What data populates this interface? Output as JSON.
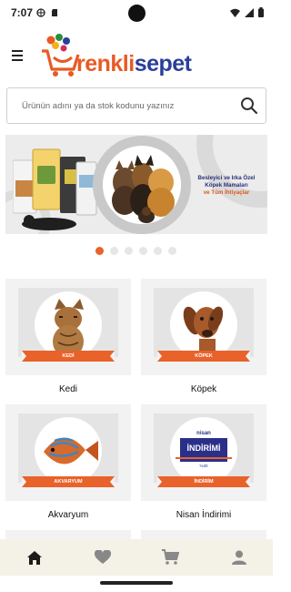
{
  "status_bar": {
    "time": "7:07"
  },
  "header": {
    "logo_text_part1": "renkli",
    "logo_text_part2": "sepet",
    "brand_colors": {
      "orange": "#e85a24",
      "blue": "#2a3f9a"
    }
  },
  "search": {
    "placeholder": "Ürünün adını ya da stok kodunu yazınız",
    "icon": "search-icon"
  },
  "banner": {
    "line1": "Besleyici ve Irka Özel",
    "line2": "Köpek Mamaları",
    "line3": "ve Tüm İhtiyaçlar",
    "slide_count": 6,
    "active_slide": 1
  },
  "categories": [
    {
      "label": "Kedi",
      "ribbon": "KEDİ"
    },
    {
      "label": "Köpek",
      "ribbon": "KÖPEK"
    },
    {
      "label": "Akvaryum",
      "ribbon": "AKVARYUM"
    },
    {
      "label": "Nisan İndirimi",
      "ribbon": "İNDİRİM",
      "badge_top": "nisan",
      "badge_main": "İNDİRİMİ",
      "badge_bottom": "%30"
    }
  ],
  "bottom_nav": {
    "items": [
      {
        "icon": "home-icon",
        "active": true
      },
      {
        "icon": "heart-icon",
        "active": false
      },
      {
        "icon": "cart-icon",
        "active": false
      },
      {
        "icon": "user-icon",
        "active": false
      }
    ]
  },
  "accent_color": "#e8622a"
}
